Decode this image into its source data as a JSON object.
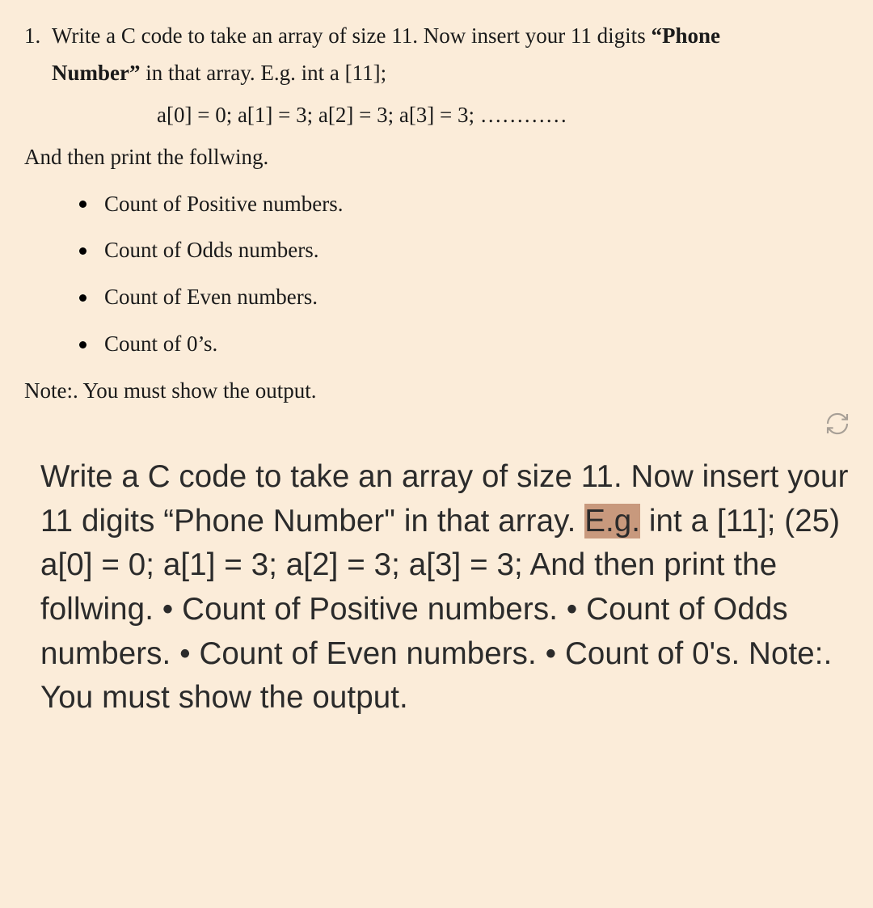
{
  "top": {
    "list_number": "1.",
    "line1_pre": "Write a C code to take an array of size 11. Now insert your 11 digits ",
    "line1_bold": "“Phone",
    "line2_bold": "Number”",
    "line2_post": " in that array. E.g. int a [11];",
    "assignments": "a[0] = 0;  a[1] = 3; a[2] = 3; a[3] = 3; …………",
    "and_then": "And then print the follwing.",
    "bullets": [
      "Count of Positive numbers.",
      "Count of Odds numbers.",
      "Count of Even numbers.",
      "Count of 0’s."
    ],
    "note": "Note:. You must show the output."
  },
  "bottom": {
    "pre_highlight": "Write a C code to take an array of size 11. Now insert your 11 digits “Phone Number\" in that array. ",
    "highlight": "E.g.",
    "post_highlight": " int a [11]; (25) a[0] = 0; a[1] = 3; a[2] = 3; a[3] = 3; And then print the follwing. • Count of Positive numbers. • Count of Odds numbers. • Count of Even numbers. • Count of 0's. Note:. You must show the output."
  }
}
